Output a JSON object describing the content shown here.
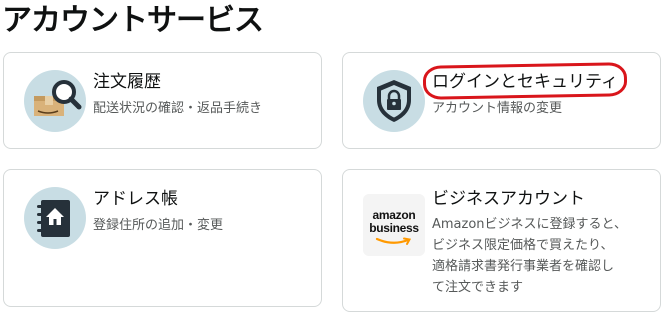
{
  "page": {
    "title": "アカウントサービス"
  },
  "cards": [
    {
      "title": "注文履歴",
      "description": "配送状況の確認・返品手続き",
      "icon": "package-search-icon"
    },
    {
      "title": "ログインとセキュリティ",
      "description": "アカウント情報の変更",
      "icon": "shield-lock-icon"
    },
    {
      "title": "アドレス帳",
      "description": "登録住所の追加・変更",
      "icon": "address-book-icon"
    },
    {
      "title": "ビジネスアカウント",
      "description": [
        "Amazonビジネスに登録すると、",
        "ビジネス限定価格で買えたり、",
        "適格請求書発行事業者を確認し",
        "て注文できます"
      ],
      "icon": "amazon-business-logo",
      "logo_text": [
        "amazon",
        "business"
      ]
    }
  ],
  "colors": {
    "icon_circle": "#c8dde4",
    "highlight": "#d9151b",
    "border": "#d5d9d9",
    "muted_text": "#565959",
    "amazon_orange": "#ff9900"
  }
}
